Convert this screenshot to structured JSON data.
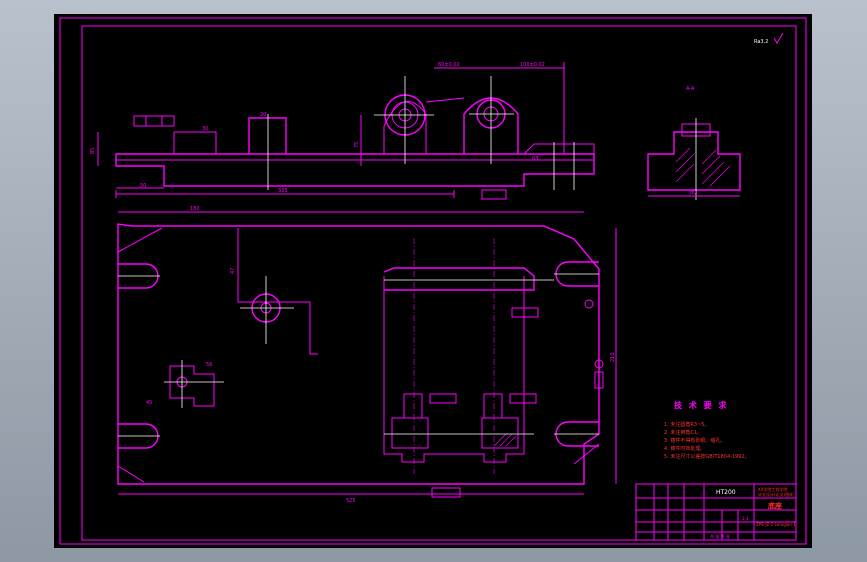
{
  "roughness_mark": "Ra3.2",
  "title_block": {
    "material": "HT200",
    "school_line1": "XX学院工程学院",
    "school_line2": "毕业设计(论文)图样",
    "drawing_name": "底座",
    "drawing_number": "ZPS-JZ-2 Lerugian-1",
    "scale": "1:1",
    "bottom_labels": "共 张 第 张"
  },
  "tech_requirements": {
    "heading": "技 术 要 求",
    "items": [
      "1. 未注圆角R3~5。",
      "2. 未注倒角C1。",
      "3. 铸件不得有砂眼、缩孔。",
      "4. 铸件时效处理。",
      "5. 未注尺寸公差按GB/T1804-1992。"
    ]
  },
  "dimensions": {
    "top_view_length": "335",
    "plan_overall_width": "525",
    "hole_spacing_a": "60±0.02",
    "hole_spacing_b": "100±0.02",
    "left_pad_width": "50",
    "right_height": "210",
    "section_width": "80",
    "left_hole_offset": "180",
    "left_vertical": "85",
    "bore_height": "75",
    "small_dim_a": "20",
    "small_dim_b": "30",
    "small_dim_c": "47",
    "small_dim_d": "45",
    "small_dim_e": "63",
    "small_dim_f": "56"
  },
  "colors": {
    "line": "#ff00ff",
    "axis": "#ffffff",
    "sheet": "#000000",
    "highlight": "#ff3030"
  }
}
